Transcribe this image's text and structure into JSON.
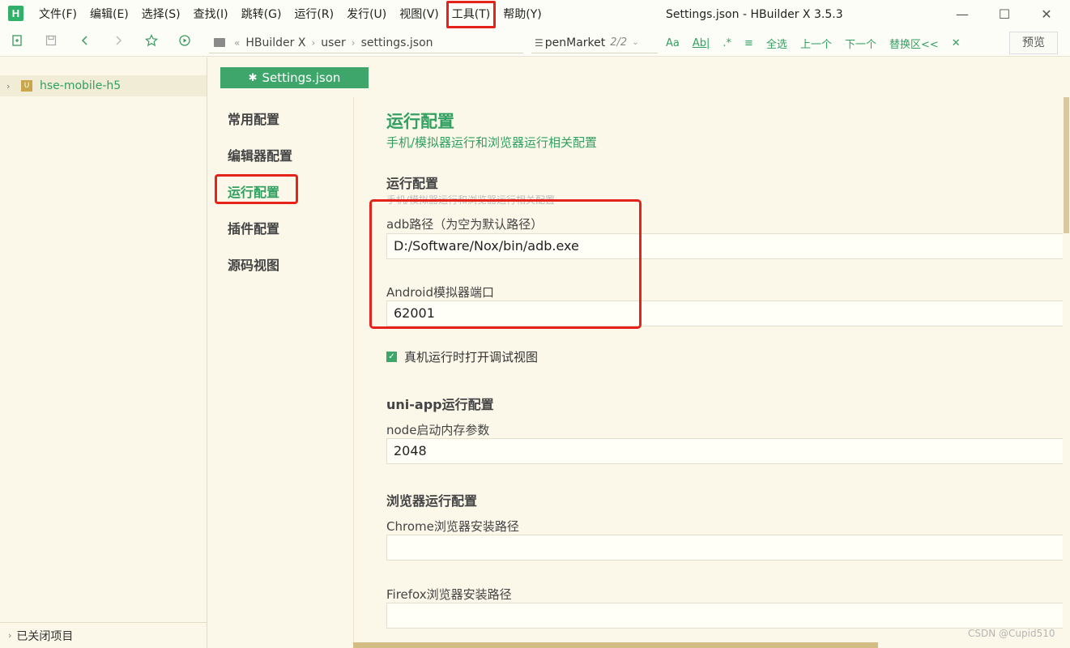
{
  "app": {
    "logo_letter": "H",
    "window_title": "Settings.json - HBuilder X 3.5.3"
  },
  "menu": [
    {
      "label": "文件(F)"
    },
    {
      "label": "编辑(E)"
    },
    {
      "label": "选择(S)"
    },
    {
      "label": "查找(I)"
    },
    {
      "label": "跳转(G)"
    },
    {
      "label": "运行(R)"
    },
    {
      "label": "发行(U)"
    },
    {
      "label": "视图(V)"
    },
    {
      "label": "工具(T)"
    },
    {
      "label": "帮助(Y)"
    }
  ],
  "window_buttons": {
    "minimize": "—",
    "maximize": "☐",
    "close": "✕"
  },
  "breadcrumb": {
    "root": "HBuilder X",
    "dir": "user",
    "file": "settings.json"
  },
  "find": {
    "query": "penMarket",
    "count": "2/2"
  },
  "find_tools": {
    "case": "Aa",
    "word": "Ab|",
    "regex": ".*",
    "align": "≡",
    "select_all": "全选",
    "prev": "上一个",
    "next": "下一个",
    "replace": "替换区<<",
    "close": "✕"
  },
  "preview_label": "预览",
  "sidebar": {
    "project_name": "hse-mobile-h5",
    "project_icon": "U",
    "closed_projects": "已关闭项目"
  },
  "tab": {
    "label": "Settings.json"
  },
  "settings_nav": [
    {
      "label": "常用配置"
    },
    {
      "label": "编辑器配置"
    },
    {
      "label": "运行配置"
    },
    {
      "label": "插件配置"
    },
    {
      "label": "源码视图"
    }
  ],
  "content": {
    "title": "运行配置",
    "subtitle": "手机/模拟器运行和浏览器运行相关配置",
    "run_section": {
      "title": "运行配置",
      "desc": "手机/模拟器运行和浏览器运行相关配置",
      "adb_label": "adb路径（为空为默认路径）",
      "adb_value": "D:/Software/Nox/bin/adb.exe",
      "port_label": "Android模拟器端口",
      "port_value": "62001",
      "debug_checkbox": "真机运行时打开调试视图"
    },
    "uniapp_section": {
      "title": "uni-app运行配置",
      "node_label": "node启动内存参数",
      "node_value": "2048"
    },
    "browser_section": {
      "title": "浏览器运行配置",
      "chrome_label": "Chrome浏览器安装路径",
      "chrome_value": "",
      "firefox_label": "Firefox浏览器安装路径",
      "firefox_value": ""
    }
  },
  "watermark": "CSDN @Cupid510"
}
